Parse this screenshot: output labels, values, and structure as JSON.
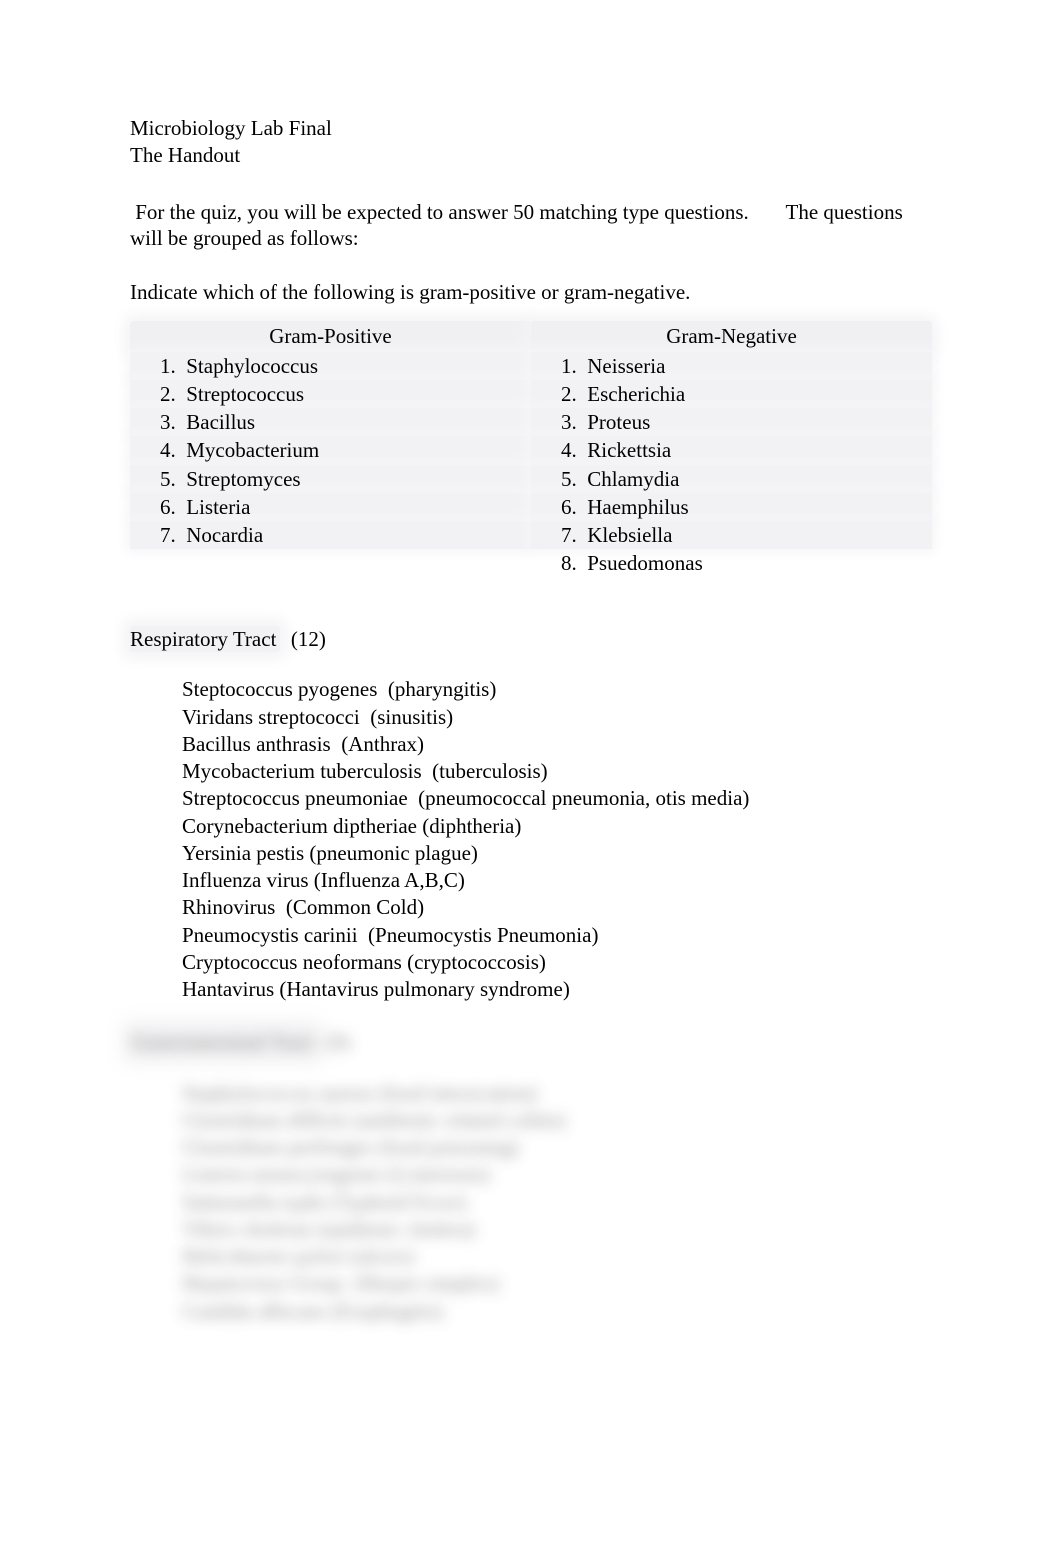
{
  "header": {
    "line1": "Microbiology Lab Final",
    "line2": "The Handout"
  },
  "intro": " For the quiz, you will be expected to answer 50 matching type questions.       The questions will be grouped as follows:",
  "indicate": "Indicate which of the following is gram-positive or gram-negative.",
  "gram_positive": {
    "title": "Gram-Positive",
    "items": [
      "1.  Staphylococcus",
      "2.  Streptococcus",
      "3.  Bacillus",
      "4.  Mycobacterium",
      "5.  Streptomyces",
      "6.  Listeria",
      "7.  Nocardia"
    ]
  },
  "gram_negative": {
    "title": "Gram-Negative",
    "items": [
      "1.  Neisseria",
      "2.  Escherichia",
      "3.  Proteus",
      "4.  Rickettsia",
      "5.  Chlamydia",
      "6.  Haemphilus",
      "7.  Klebsiella",
      "8.  Psuedomonas"
    ]
  },
  "respiratory": {
    "title_hl": "Respiratory Tract",
    "title_rest": "  (12)",
    "items": [
      "Steptococcus pyogenes  (pharyngitis)",
      "Viridans streptococci  (sinusitis)",
      "Bacillus anthrasis  (Anthrax)",
      "Mycobacterium tuberculosis  (tuberculosis)",
      "Streptococcus pneumoniae  (pneumococcal pneumonia, otis media)",
      "Corynebacterium diptheriae (diphtheria)",
      "Yersinia pestis (pneumonic plague)",
      "Influenza virus (Influenza A,B,C)",
      "Rhinovirus  (Common Cold)",
      "Pneumocystis carinii  (Pneumocystis Pneumonia)",
      "Cryptococcus neoformans (cryptococcosis)",
      "Hantavirus (Hantavirus pulmonary syndrome)"
    ]
  },
  "gi": {
    "title_hl": "Gastrointestinal Tract",
    "title_rest": "  (9)",
    "items": [
      "Staphylococcus aureus (food intoxication)",
      "Clostridium difficle (antibiotic related colitis)",
      "Clostridium perfringes (food poisoning)",
      "Listeria monocytogenes (Listeriosis)",
      "Salmonella typhi (Typhoid Fever)",
      "Vibrio cholerae (epidemic cholera)",
      "Helicobacter pylori (ulcers)",
      "Hepatovirus Group  (Herpes simplex)",
      "Candida albicans (Esophagitis)"
    ]
  }
}
